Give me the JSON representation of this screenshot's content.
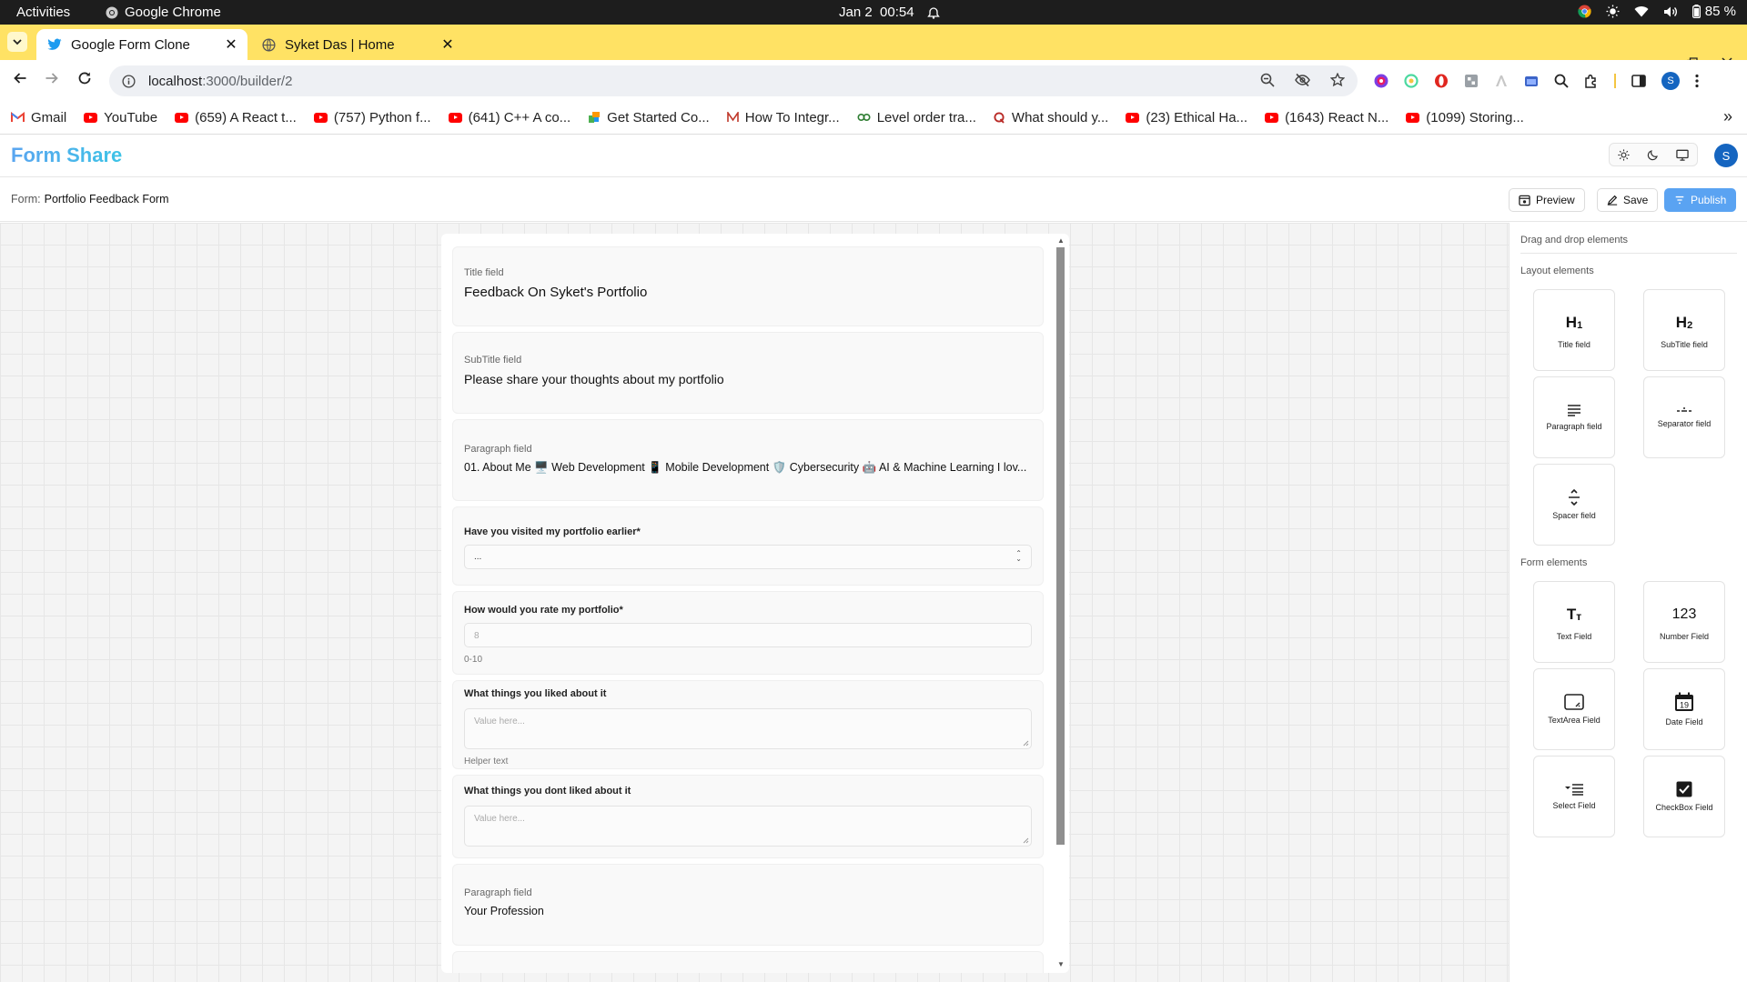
{
  "system_bar": {
    "activities": "Activities",
    "app_name": "Google Chrome",
    "date": "Jan 2",
    "time": "00:54",
    "battery": "85 %"
  },
  "tabs": [
    {
      "title": "Google Form Clone",
      "icon": "twitter-bird-icon"
    },
    {
      "title": "Syket Das | Home",
      "icon": "globe-icon"
    }
  ],
  "address_bar": {
    "host": "localhost",
    "path": ":3000/builder/2"
  },
  "profile_initial": "S",
  "bookmarks": [
    {
      "label": "Gmail",
      "icon": "gmail-icon"
    },
    {
      "label": "YouTube",
      "icon": "youtube-icon"
    },
    {
      "label": "(659) A React t...",
      "icon": "youtube-icon"
    },
    {
      "label": "(757) Python f...",
      "icon": "youtube-icon"
    },
    {
      "label": "(641) C++ A co...",
      "icon": "youtube-icon"
    },
    {
      "label": "Get Started Co...",
      "icon": "puzzle-icon"
    },
    {
      "label": "How To Integr...",
      "icon": "medium-icon"
    },
    {
      "label": "Level order tra...",
      "icon": "link-icon"
    },
    {
      "label": "What should y...",
      "icon": "quora-icon"
    },
    {
      "label": "(23) Ethical Ha...",
      "icon": "youtube-icon"
    },
    {
      "label": "(1643) React N...",
      "icon": "youtube-icon"
    },
    {
      "label": "(1099) Storing...",
      "icon": "youtube-icon"
    }
  ],
  "app": {
    "brand": "Form Share",
    "avatar_initial": "S"
  },
  "form_bar": {
    "label": "Form:",
    "form_name": "Portfolio Feedback Form",
    "preview": "Preview",
    "save": "Save",
    "publish": "Publish"
  },
  "form": {
    "title_field": {
      "caption": "Title field",
      "value": "Feedback On Syket's Portfolio"
    },
    "subtitle_field": {
      "caption": "SubTitle field",
      "value": "Please share your thoughts about my portfolio"
    },
    "paragraph_field": {
      "caption": "Paragraph field",
      "value": "01. About Me 🖥️ Web Development 📱 Mobile Development 🛡️ Cybersecurity 🤖 AI & Machine Learning I lov..."
    },
    "select_question": {
      "label": "Have you visited my portfolio earlier*",
      "value": "..."
    },
    "rating_question": {
      "label": "How would you rate my portfolio*",
      "placeholder": "8",
      "helper": "0-10"
    },
    "liked_question": {
      "label": "What things you liked about it",
      "placeholder": "Value here...",
      "helper": "Helper text"
    },
    "disliked_question": {
      "label": "What things you dont liked about it",
      "placeholder": "Value here..."
    },
    "paragraph_field_2": {
      "caption": "Paragraph field",
      "value": "Your Profession"
    }
  },
  "sidebar": {
    "heading": "Drag and drop elements",
    "layout_heading": "Layout elements",
    "form_heading": "Form elements",
    "layout_elements": [
      {
        "label": "Title field",
        "glyph": "H1",
        "icon": "h1-icon"
      },
      {
        "label": "SubTitle field",
        "glyph": "H2",
        "icon": "h2-icon"
      },
      {
        "label": "Paragraph field",
        "icon": "paragraph-icon"
      },
      {
        "label": "Separator field",
        "icon": "separator-icon"
      },
      {
        "label": "Spacer field",
        "icon": "spacer-icon"
      }
    ],
    "form_elements": [
      {
        "label": "Text Field",
        "glyph": "Tт",
        "icon": "text-icon"
      },
      {
        "label": "Number Field",
        "glyph": "123",
        "icon": "number-icon"
      },
      {
        "label": "TextArea Field",
        "icon": "textarea-icon"
      },
      {
        "label": "Date Field",
        "glyph": "19",
        "icon": "calendar-icon"
      },
      {
        "label": "Select Field",
        "icon": "select-list-icon"
      },
      {
        "label": "CheckBox Field",
        "icon": "checkbox-icon"
      }
    ]
  }
}
